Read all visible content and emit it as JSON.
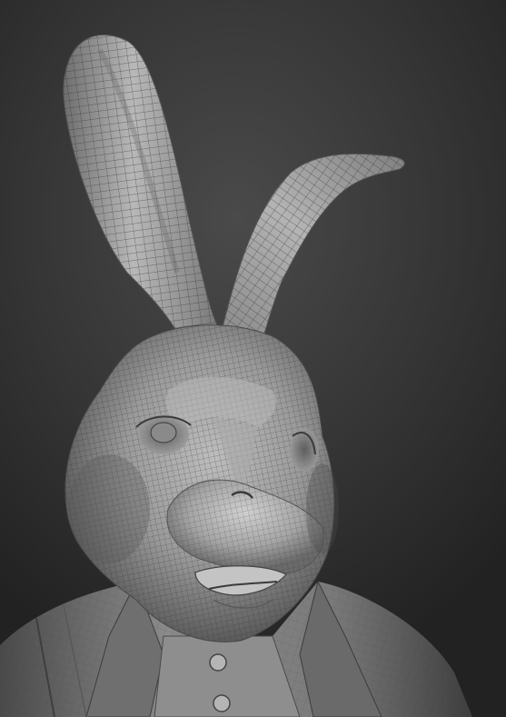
{
  "viewport": {
    "background_color": "#2e2e2e",
    "model_color": "#a8a8a8",
    "wire_color": "#3a3a3a"
  },
  "subject": {
    "icon": "rabbit-sculpt-icon"
  }
}
